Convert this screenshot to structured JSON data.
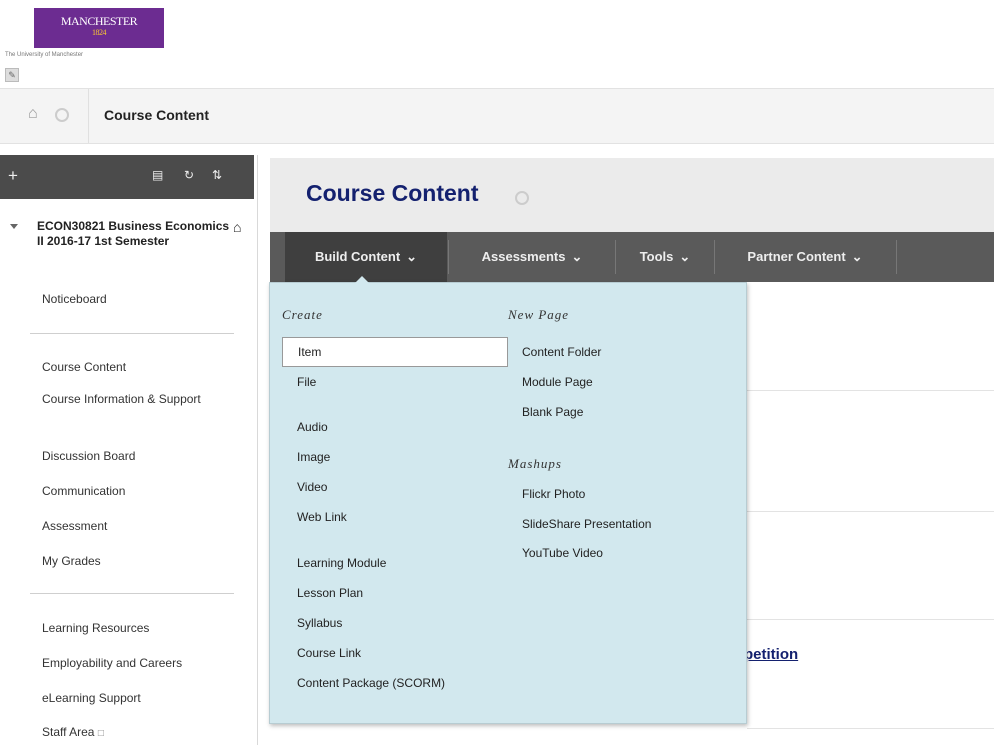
{
  "header": {
    "logo_text": "MANCHESTER",
    "logo_year": "1824",
    "logo_subtitle": "The University of Manchester"
  },
  "breadcrumb": {
    "title": "Course Content"
  },
  "leftnav": {
    "course_name": "ECON30821 Business Economics II 2016-17 1st Semester",
    "items_group1": [
      "Noticeboard"
    ],
    "items_group2": [
      "Course Content",
      "Course Information & Support",
      "Discussion Board",
      "Communication",
      "Assessment",
      "My Grades"
    ],
    "items_group3": [
      "Learning Resources",
      "Employability and Careers",
      "eLearning Support",
      "Staff Area"
    ]
  },
  "content": {
    "page_title": "Course Content",
    "tabs": [
      "Build Content",
      "Assessments",
      "Tools",
      "Partner Content"
    ],
    "peek_link": "petition"
  },
  "dropdown": {
    "create_heading": "Create",
    "create_items": [
      "Item",
      "File",
      "Audio",
      "Image",
      "Video",
      "Web Link",
      "Learning Module",
      "Lesson Plan",
      "Syllabus",
      "Course Link",
      "Content Package (SCORM)"
    ],
    "newpage_heading": "New Page",
    "newpage_items": [
      "Content Folder",
      "Module Page",
      "Blank Page"
    ],
    "mashups_heading": "Mashups",
    "mashups_items": [
      "Flickr Photo",
      "SlideShare Presentation",
      "YouTube Video"
    ]
  },
  "icons": {
    "home": "home-icon",
    "add": "plus-icon",
    "folder": "folder-icon",
    "refresh": "refresh-icon",
    "sort": "sort-icon",
    "chevron": "chevron-down-icon",
    "edit": "edit-icon"
  },
  "colors": {
    "brand_purple": "#6c2c91",
    "title_navy": "#14216f",
    "menubar": "#5a5a5a",
    "dropdown_bg": "#d2e8ee"
  }
}
